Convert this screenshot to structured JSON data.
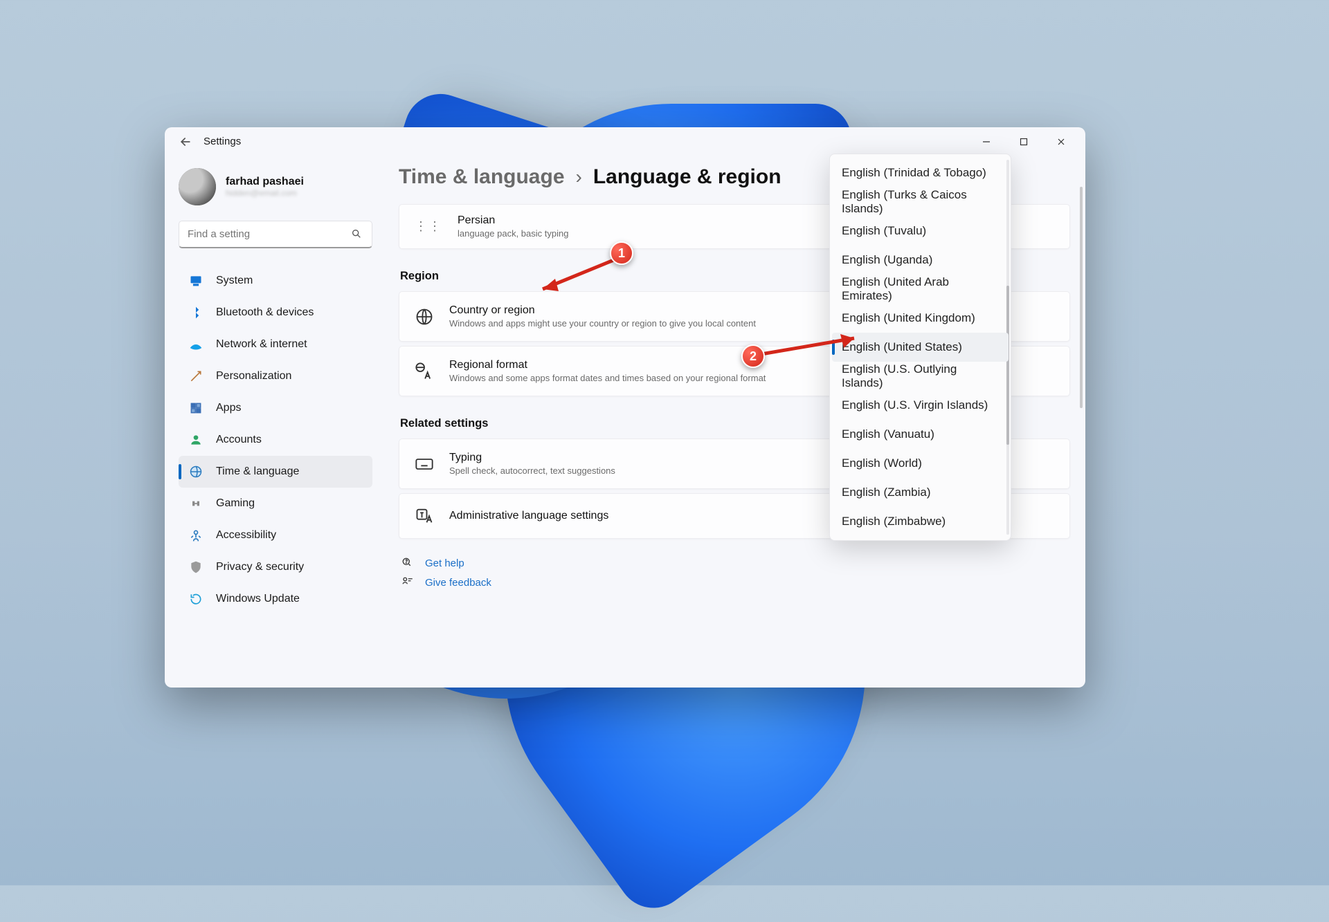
{
  "app_title": "Settings",
  "window_controls": {
    "min": "minimize",
    "max": "maximize",
    "close": "close"
  },
  "profile": {
    "name": "farhad pashaei",
    "email": "hidden@email.com"
  },
  "search": {
    "placeholder": "Find a setting"
  },
  "sidebar": {
    "items": [
      {
        "label": "System"
      },
      {
        "label": "Bluetooth & devices"
      },
      {
        "label": "Network & internet"
      },
      {
        "label": "Personalization"
      },
      {
        "label": "Apps"
      },
      {
        "label": "Accounts"
      },
      {
        "label": "Time & language"
      },
      {
        "label": "Gaming"
      },
      {
        "label": "Accessibility"
      },
      {
        "label": "Privacy & security"
      },
      {
        "label": "Windows Update"
      }
    ],
    "active_index": 6
  },
  "breadcrumb": {
    "parent": "Time & language",
    "current": "Language & region"
  },
  "language_row": {
    "title": "Persian",
    "subtitle": "language pack, basic typing"
  },
  "sections": {
    "region": {
      "title": "Region",
      "country": {
        "title": "Country or region",
        "subtitle": "Windows and apps might use your country or region to give you local content"
      },
      "format": {
        "title": "Regional format",
        "subtitle": "Windows and some apps format dates and times based on your regional format"
      }
    },
    "related": {
      "title": "Related settings",
      "typing": {
        "title": "Typing",
        "subtitle": "Spell check, autocorrect, text suggestions"
      },
      "admin": {
        "title": "Administrative language settings"
      }
    }
  },
  "help": {
    "get_help": "Get help",
    "feedback": "Give feedback"
  },
  "dropdown": {
    "options": [
      "English (Trinidad & Tobago)",
      "English (Turks & Caicos Islands)",
      "English (Tuvalu)",
      "English (Uganda)",
      "English (United Arab Emirates)",
      "English (United Kingdom)",
      "English (United States)",
      "English (U.S. Outlying Islands)",
      "English (U.S. Virgin Islands)",
      "English (Vanuatu)",
      "English (World)",
      "English (Zambia)",
      "English (Zimbabwe)"
    ],
    "selected_index": 6
  },
  "markers": {
    "one": "1",
    "two": "2"
  }
}
